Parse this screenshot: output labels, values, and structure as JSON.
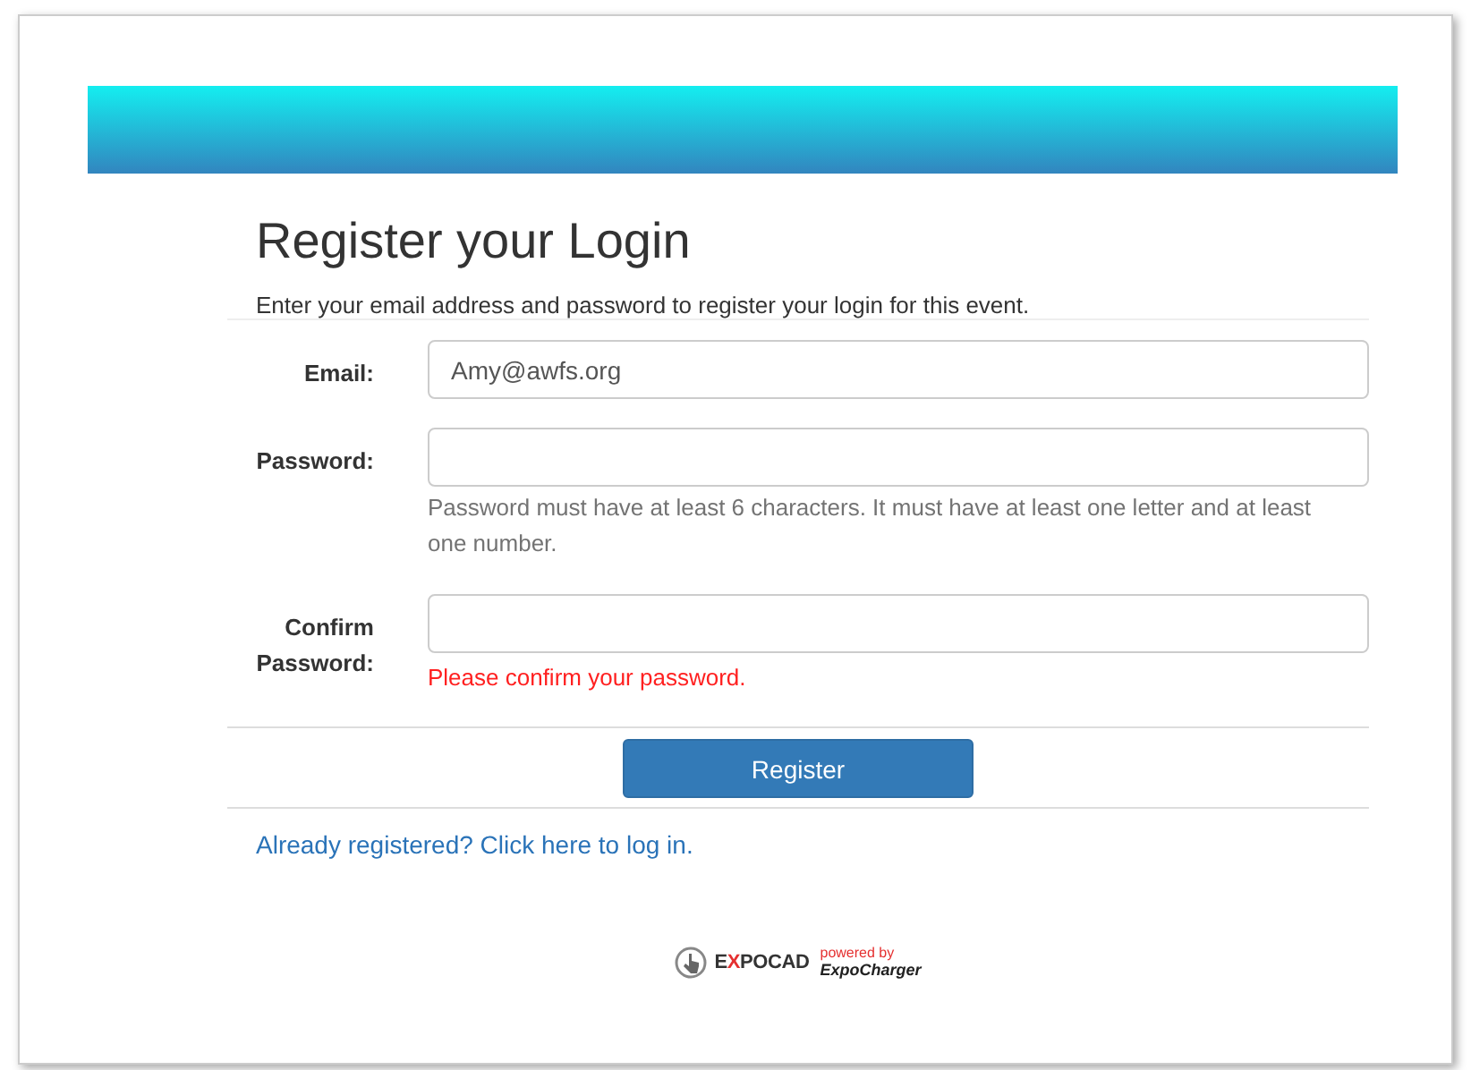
{
  "title": "Register your Login",
  "subtitle": "Enter your email address and password to register your login for this event.",
  "fields": [
    {
      "label": "Email:",
      "value": "Amy@awfs.org",
      "kind": "text"
    },
    {
      "label": "Password:",
      "kind": "password",
      "hint": "Password must have at least 6 characters. It must have at least one letter and at least one number."
    },
    {
      "label": "Confirm Password:",
      "kind": "password",
      "error": "Please confirm your password."
    }
  ],
  "button": "Register",
  "login_link": "Already registered? Click here to log in.",
  "footer": {
    "brand": [
      "E",
      "X",
      "POCAD"
    ],
    "powered_by": "powered by",
    "partner": "ExpoCharger"
  }
}
